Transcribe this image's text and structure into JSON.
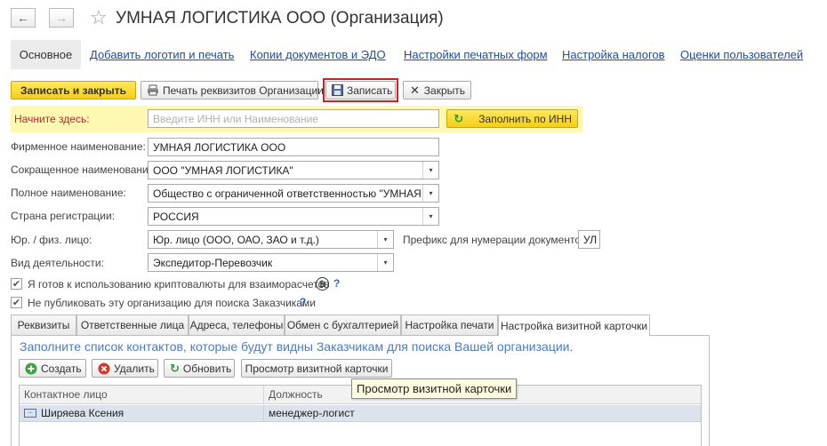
{
  "window": {
    "title": "УМНАЯ ЛОГИСТИКА ООО (Организация)",
    "back_icon": "arrow-left",
    "forward_icon": "arrow-right",
    "favorite_icon": "star"
  },
  "sections": [
    {
      "label": "Основное",
      "active": true
    },
    {
      "label": "Добавить логотип и печать"
    },
    {
      "label": "Копии документов и ЭДО"
    },
    {
      "label": "Настройки печатных форм"
    },
    {
      "label": "Настройка налогов"
    },
    {
      "label": "Оценки пользователей"
    }
  ],
  "toolbar": {
    "save_close": "Записать и закрыть",
    "print_details": "Печать реквизитов Организации",
    "save": "Записать",
    "close": "Закрыть"
  },
  "start": {
    "label": "Начните здесь:",
    "placeholder": "Введите ИНН или Наименование",
    "fill_button": "Заполнить по ИНН"
  },
  "form": {
    "firm_name_label": "Фирменное наименование:",
    "firm_name_value": "УМНАЯ ЛОГИСТИКА ООО",
    "short_name_label": "Сокращенное наименование:",
    "short_name_value": "ООО \"УМНАЯ ЛОГИСТИКА\"",
    "full_name_label": "Полное наименование:",
    "full_name_value": "Общество с ограниченной ответственностью \"УМНАЯ ЛОГ",
    "country_label": "Страна регистрации:",
    "country_value": "РОССИЯ",
    "entity_label": "Юр. / физ. лицо:",
    "entity_value": "Юр. лицо (ООО, ОАО, ЗАО и т.д.)",
    "prefix_label": "Префикс для нумерации документов :",
    "prefix_value": "УЛ",
    "activity_label": "Вид деятельности:",
    "activity_value": "Экспедитор-Перевозчик",
    "crypto_label": "Я готов к использованию криптовалюты для взаиморасчетов",
    "crypto_checked": true,
    "nopublish_label": "Не публиковать эту организацию для поиска Заказчиками",
    "nopublish_checked": true,
    "help_mark": "?",
    "btc_symbol": "₿"
  },
  "tabs": [
    {
      "label": "Реквизиты"
    },
    {
      "label": "Ответственные лица"
    },
    {
      "label": "Адреса, телефоны"
    },
    {
      "label": "Обмен с бухгалтерией"
    },
    {
      "label": "Настройка печати"
    },
    {
      "label": "Настройка визитной карточки",
      "active": true
    }
  ],
  "panel": {
    "hint": "Заполните список контактов, которые будут видны Заказчикам для поиска Вашей организации.",
    "create": "Создать",
    "delete": "Удалить",
    "refresh": "Обновить",
    "preview": "Просмотр визитной карточки",
    "tooltip": "Просмотр визитной карточки"
  },
  "table": {
    "columns": [
      "Контактное лицо",
      "Должность"
    ],
    "rows": [
      {
        "contact": "Ширяева Ксения",
        "position": "менеджер-логист"
      }
    ]
  },
  "colors": {
    "accent_yellow": "#f5cf17",
    "highlight_red": "#d21f1f",
    "link_blue": "#1a4ea8",
    "start_strip": "#fff8b2"
  }
}
